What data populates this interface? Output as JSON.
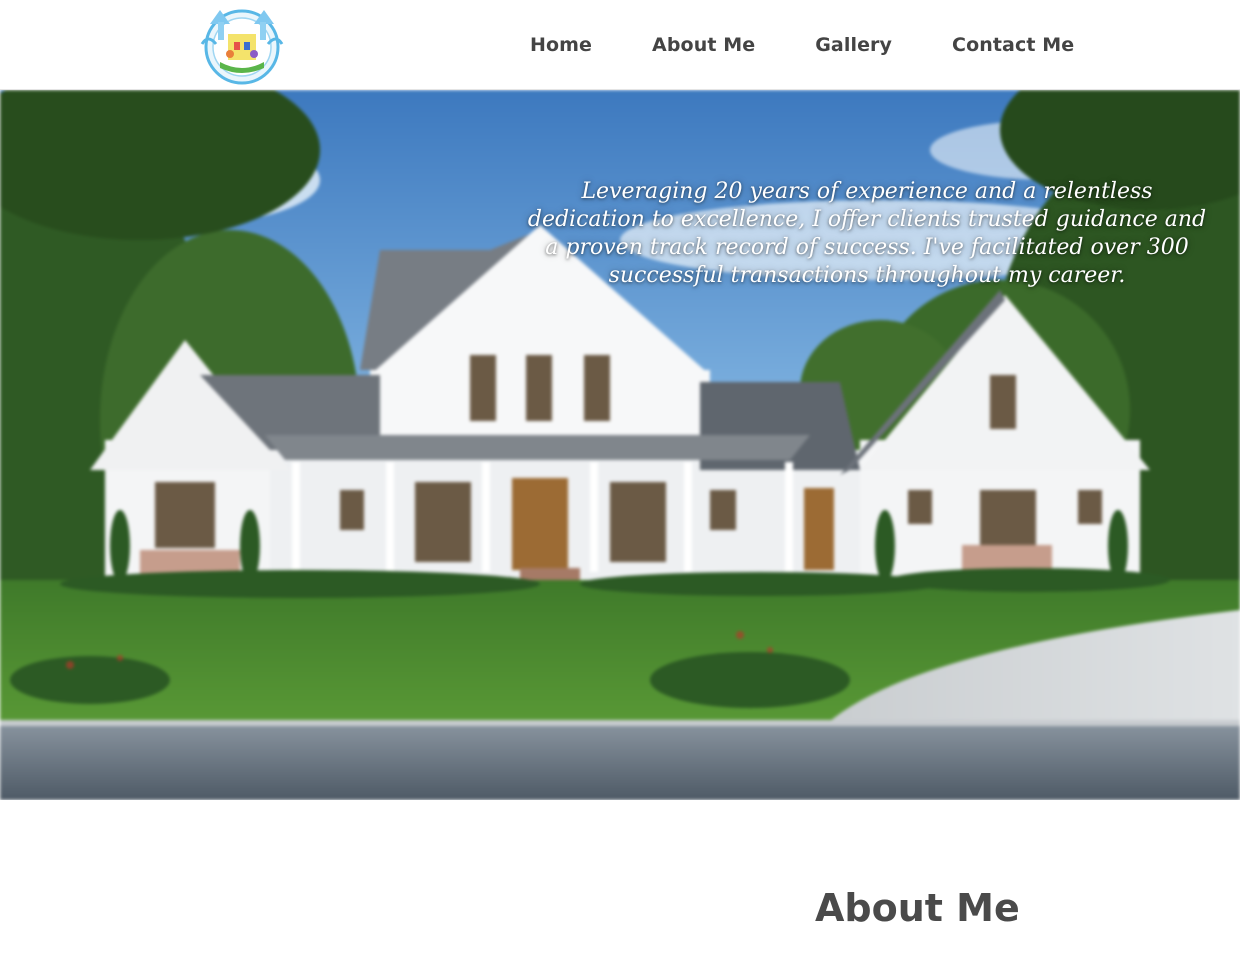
{
  "header": {
    "logo_icon": "castle-crest-logo-icon"
  },
  "nav": {
    "items": [
      {
        "label": "Home"
      },
      {
        "label": "About Me"
      },
      {
        "label": "Gallery"
      },
      {
        "label": "Contact Me"
      }
    ]
  },
  "hero": {
    "tagline": "Leveraging 20 years of experience and a relentless dedication to excellence, I offer clients trusted guidance and a proven track record of success. I've facilitated over 300 successful transactions throughout my career.",
    "background_icon": "farmhouse-photo"
  },
  "about": {
    "title": "About Me"
  },
  "colors": {
    "nav_text": "#444444",
    "heading_text": "#4a4a4a",
    "hero_text": "#ffffff"
  }
}
